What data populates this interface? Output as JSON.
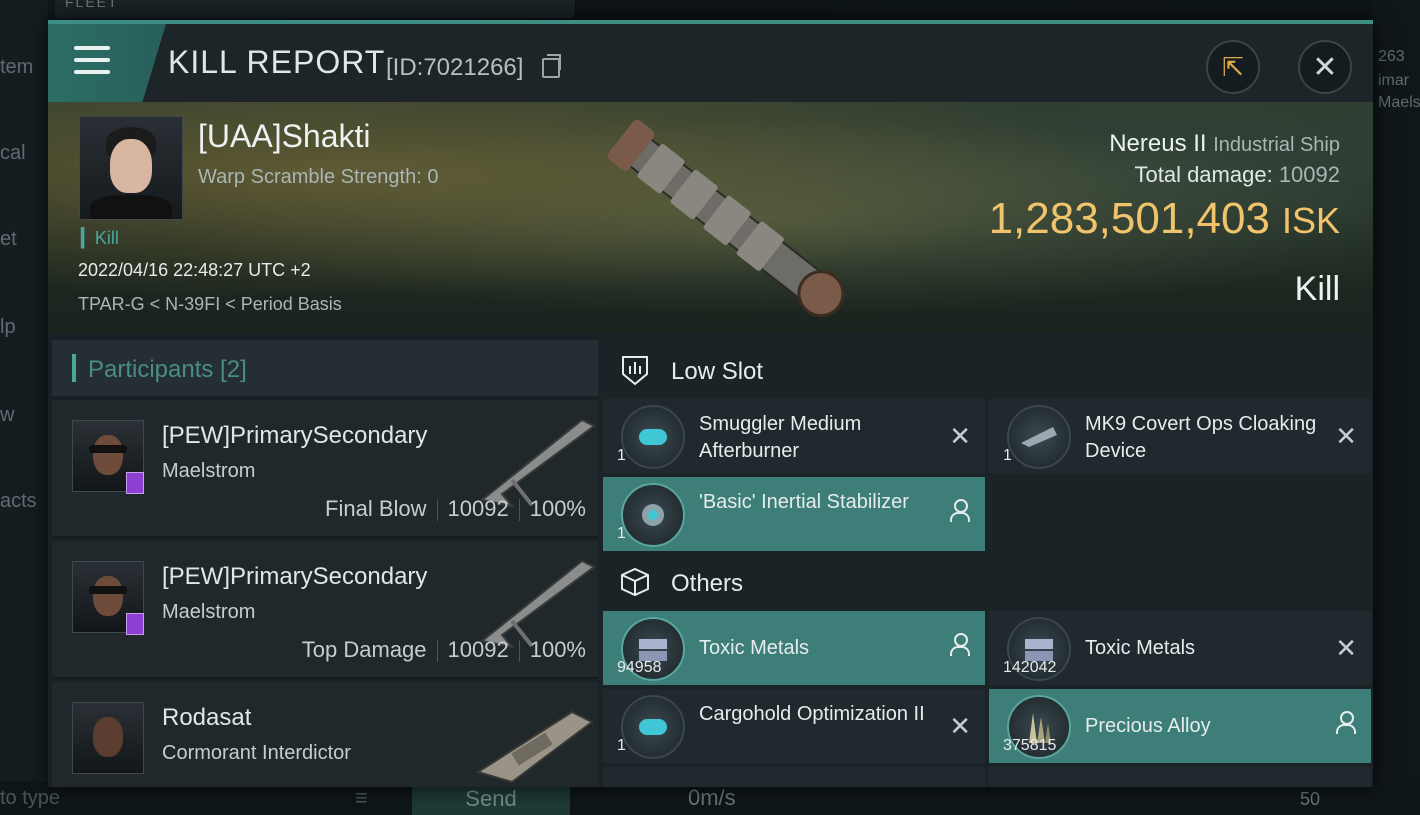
{
  "background": {
    "left_labels": [
      "tem",
      "cal",
      "et",
      "lp",
      "w",
      "acts"
    ],
    "top_label": "FLEET",
    "right_labels": [
      "263",
      "imar",
      "Maels"
    ],
    "bottom": {
      "type_hint": "to type",
      "send_label": "Send",
      "speed": "0m/s",
      "count": "50"
    }
  },
  "header": {
    "menu_icon": "hamburger-icon",
    "title": "KILL REPORT",
    "report_id": "[ID:7021266]",
    "share_icon": "external-link-icon",
    "close_icon": "close-icon",
    "close_glyph": "✕",
    "share_glyph": "⇱"
  },
  "victim": {
    "name": "[UAA]Shakti",
    "warp_scramble": "Warp Scramble Strength: 0",
    "kill_tag": "Kill",
    "datetime": "2022/04/16 22:48:27 UTC +2",
    "location": "TPAR-G < N-39FI < Period Basis"
  },
  "ship": {
    "name": "Nereus II",
    "class": "Industrial Ship",
    "total_damage_label": "Total damage:",
    "total_damage": "10092",
    "value": "1,283,501,403",
    "currency": "ISK",
    "result": "Kill"
  },
  "participants": {
    "header": "Participants [2]",
    "rows": [
      {
        "name": "[PEW]PrimarySecondary",
        "ship": "Maelstrom",
        "role": "Final Blow",
        "damage": "10092",
        "percent": "100%"
      },
      {
        "name": "[PEW]PrimarySecondary",
        "ship": "Maelstrom",
        "role": "Top Damage",
        "damage": "10092",
        "percent": "100%"
      },
      {
        "name": "Rodasat",
        "ship": "Cormorant Interdictor",
        "role": "",
        "damage": "",
        "percent": ""
      }
    ]
  },
  "sections": {
    "low_slot": {
      "title": "Low Slot",
      "icon": "low-slot-icon",
      "items": [
        {
          "name": "Smuggler Medium Afterburner",
          "qty": "1",
          "status": "destroyed"
        },
        {
          "name": "MK9 Covert Ops Cloaking Device",
          "qty": "1",
          "status": "destroyed"
        },
        {
          "name": "'Basic' Inertial Stabilizer",
          "qty": "1",
          "status": "dropped"
        }
      ]
    },
    "others": {
      "title": "Others",
      "icon": "cargo-box-icon",
      "items": [
        {
          "name": "Toxic Metals",
          "qty": "94958",
          "status": "dropped"
        },
        {
          "name": "Toxic Metals",
          "qty": "142042",
          "status": "destroyed"
        },
        {
          "name": "Cargohold Optimization II",
          "qty": "1",
          "status": "destroyed"
        },
        {
          "name": "Precious Alloy",
          "qty": "375815",
          "status": "dropped"
        }
      ]
    }
  },
  "colors": {
    "accent": "#3d8f86",
    "isk": "#f0c36c",
    "dropped_bg": "#3d7f78"
  }
}
